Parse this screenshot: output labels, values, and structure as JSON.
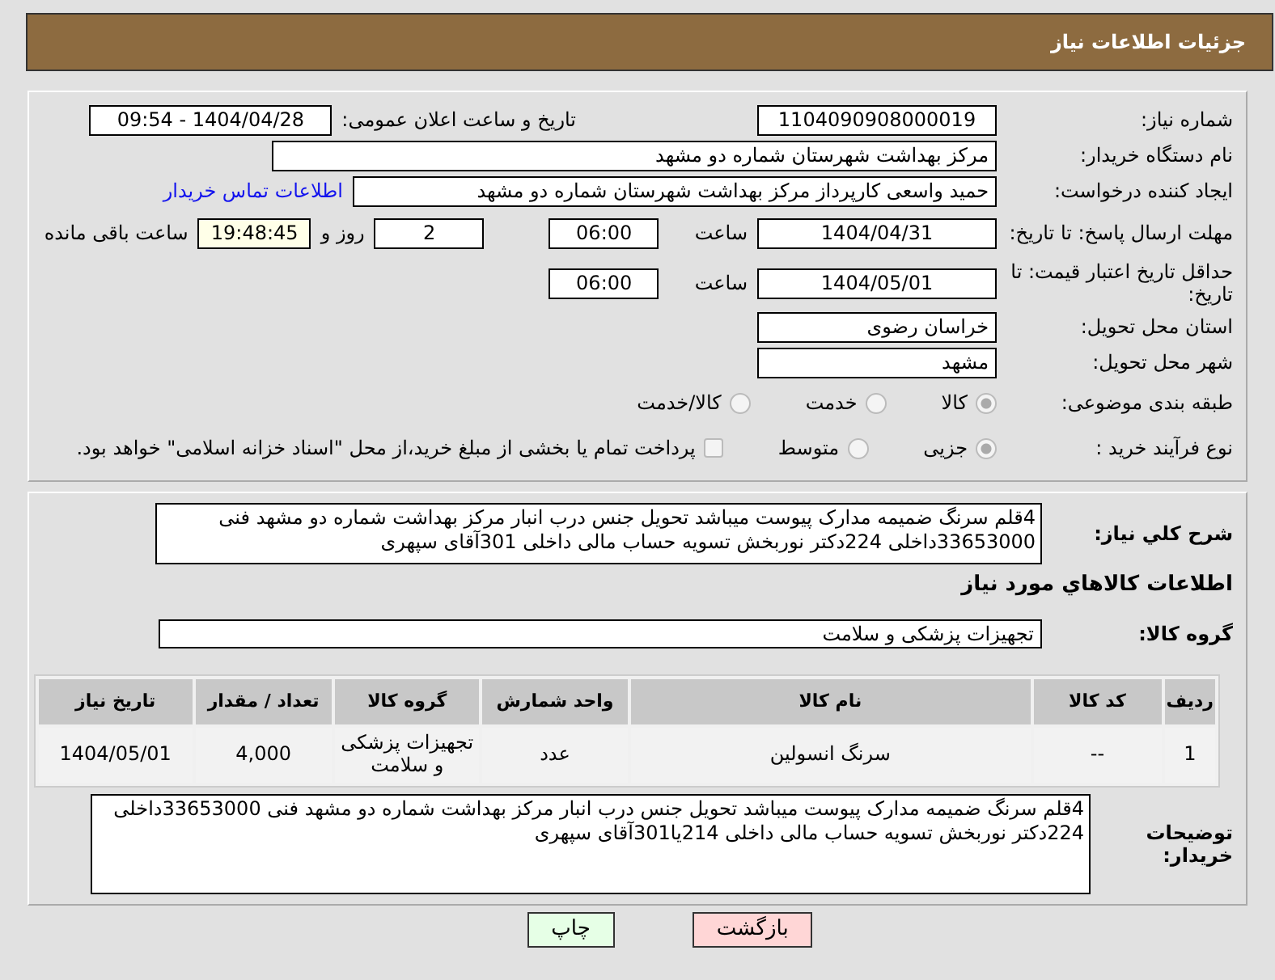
{
  "header": {
    "title": "جزئیات اطلاعات نیاز"
  },
  "need_number": {
    "label": "شماره نیاز:",
    "value": "1104090908000019"
  },
  "announce": {
    "label": "تاریخ و ساعت اعلان عمومی:",
    "value": "1404/04/28 - 09:54"
  },
  "buyer_org": {
    "label": "نام دستگاه خریدار:",
    "value": "مرکز بهداشت شهرستان شماره دو مشهد"
  },
  "requester": {
    "label": "ایجاد کننده درخواست:",
    "value": "حمید واسعی کارپرداز مرکز بهداشت شهرستان شماره دو مشهد",
    "link": "اطلاعات تماس خریدار"
  },
  "deadline": {
    "label": "مهلت ارسال پاسخ: تا تاریخ:",
    "date": "1404/04/31",
    "time_label": "ساعت",
    "time": "06:00",
    "days": "2",
    "days_label": "روز و",
    "remaining": "19:48:45",
    "remaining_label": "ساعت باقی مانده"
  },
  "validity": {
    "label": "حداقل تاریخ اعتبار قیمت: تا تاریخ:",
    "date": "1404/05/01",
    "time_label": "ساعت",
    "time": "06:00"
  },
  "province": {
    "label": "استان محل تحویل:",
    "value": "خراسان رضوی"
  },
  "city": {
    "label": "شهر محل تحویل:",
    "value": "مشهد"
  },
  "category": {
    "label": "طبقه بندی موضوعی:",
    "options": [
      {
        "label": "کالا",
        "selected": true
      },
      {
        "label": "خدمت",
        "selected": false
      },
      {
        "label": "کالا/خدمت",
        "selected": false
      }
    ]
  },
  "process": {
    "label": "نوع فرآیند خرید :",
    "options": [
      {
        "label": "جزیی",
        "selected": true
      },
      {
        "label": "متوسط",
        "selected": false
      }
    ],
    "treasury": {
      "checked": false,
      "text": "پرداخت تمام یا بخشی از مبلغ خرید،از محل \"اسناد خزانه اسلامی\" خواهد بود."
    }
  },
  "summary": {
    "label": "شرح کلي نياز:",
    "value": "4قلم سرنگ ضمیمه مدارک پیوست میباشد تحویل جنس درب انبار مرکز بهداشت شماره دو مشهد فنی 33653000داخلی 224دکتر نوربخش تسویه حساب مالی داخلی 301آقای سپهری"
  },
  "goods_heading": "اطلاعات کالاهاي مورد نياز",
  "goods_group": {
    "label": "گروه کالا:",
    "value": "تجهیزات پزشکی و سلامت"
  },
  "table": {
    "columns": [
      "ردیف",
      "کد کالا",
      "نام کالا",
      "واحد شمارش",
      "گروه کالا",
      "تعداد / مقدار",
      "تاریخ نیاز"
    ],
    "rows": [
      [
        "1",
        "--",
        "سرنگ انسولین",
        "عدد",
        "تجهیزات پزشکی و سلامت",
        "4,000",
        "1404/05/01"
      ]
    ]
  },
  "buyer_notes": {
    "label": "توضیحات خریدار:",
    "value": "4قلم سرنگ ضمیمه مدارک پیوست میباشد تحویل جنس درب انبار مرکز بهداشت شماره دو مشهد فنی 33653000داخلی 224دکتر نوربخش تسویه حساب مالی داخلی 214یا301آقای سپهری"
  },
  "buttons": [
    {
      "label": "بازگشت",
      "kind": "back"
    },
    {
      "label": "چاپ",
      "kind": "print"
    }
  ]
}
